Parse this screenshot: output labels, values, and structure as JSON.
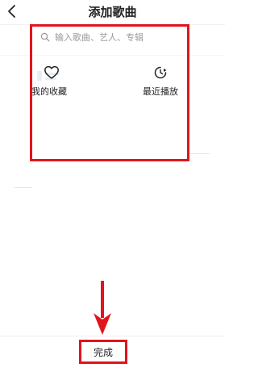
{
  "header": {
    "title": "添加歌曲"
  },
  "search": {
    "placeholder": "输入歌曲、艺人、专辑",
    "value": ""
  },
  "quick_access": [
    {
      "label": "我的收藏",
      "icon": "heart-icon"
    },
    {
      "label": "最近播放",
      "icon": "recent-play-icon"
    }
  ],
  "footer": {
    "done_label": "完成"
  },
  "colors": {
    "annotation": "#e1141c",
    "text": "#222222",
    "placeholder": "#9a9a9a"
  }
}
